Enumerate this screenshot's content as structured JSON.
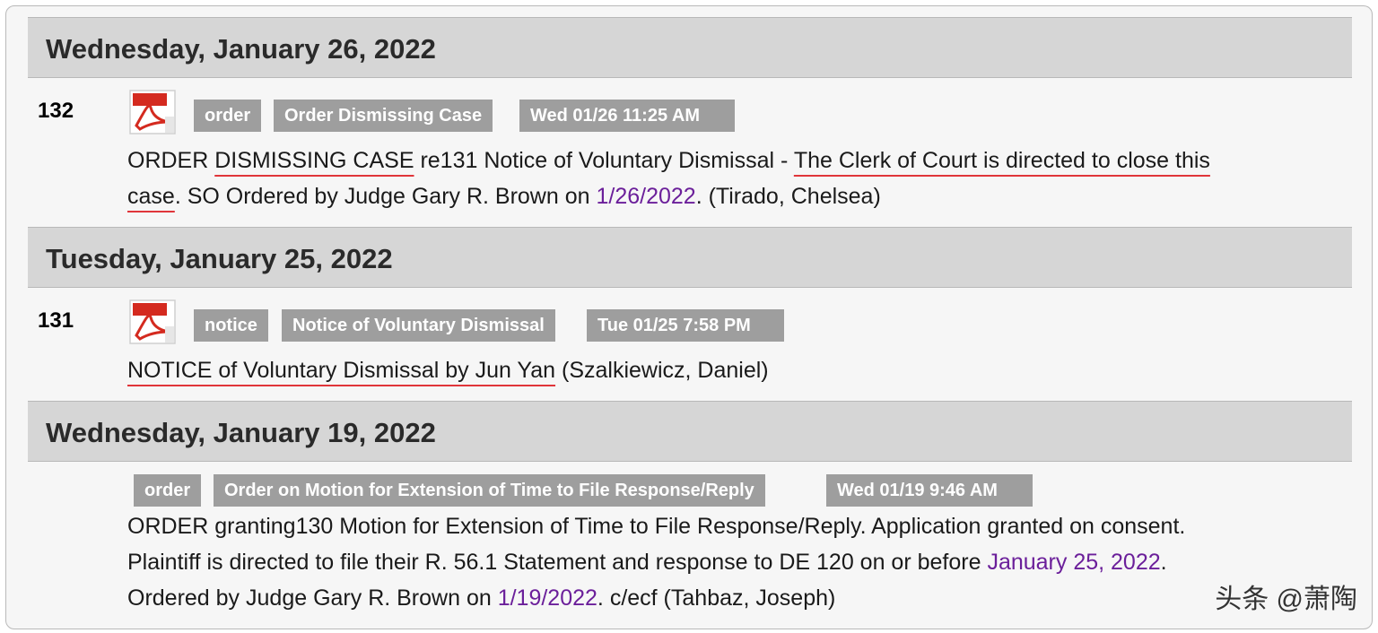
{
  "entries": [
    {
      "day": "Wednesday, January 26, 2022",
      "doc_number": "132",
      "tags": [
        "order",
        "Order Dismissing Case",
        "Wed 01/26 11:25 AM"
      ],
      "text": {
        "l1_a": "ORDER ",
        "l1_b": "DISMISSING CASE",
        "l1_c": " re131 Notice of Voluntary Dismissal - ",
        "l1_d": "The Clerk of Court is directed to close this",
        "l2_a": "case",
        "l2_b": ". SO Ordered by Judge Gary R. Brown on ",
        "l2_date": "1/26/2022",
        "l2_c": ". (Tirado, Chelsea)"
      }
    },
    {
      "day": "Tuesday, January 25, 2022",
      "doc_number": "131",
      "tags": [
        "notice",
        "Notice of Voluntary Dismissal",
        "Tue 01/25 7:58 PM"
      ],
      "text": {
        "l1_a": "NOTICE of Voluntary Dismissal by Jun Yan",
        "l1_b": " (Szalkiewicz, Daniel)"
      }
    },
    {
      "day": "Wednesday, January 19, 2022",
      "tags": [
        "order",
        "Order on Motion for Extension of Time to File Response/Reply",
        "Wed 01/19 9:46 AM"
      ],
      "text": {
        "l1": "ORDER granting130 Motion for Extension of Time to File Response/Reply. Application granted on consent.",
        "l2_a": "Plaintiff is directed to file their R. 56.1 Statement and response to DE 120 on or before ",
        "l2_date": "January 25, 2022",
        "l2_b": ".",
        "l3_a": "Ordered by Judge Gary R. Brown on ",
        "l3_date": "1/19/2022",
        "l3_b": ". c/ecf (Tahbaz, Joseph)"
      }
    }
  ],
  "watermark": "头条 @萧陶",
  "colors": {
    "header_bg": "#d6d6d6",
    "tag_bg": "#9e9e9e",
    "link": "#6b1f9a",
    "underline": "#e0353a",
    "pdf_red": "#d42a1f"
  },
  "icons": [
    "pdf-icon"
  ]
}
